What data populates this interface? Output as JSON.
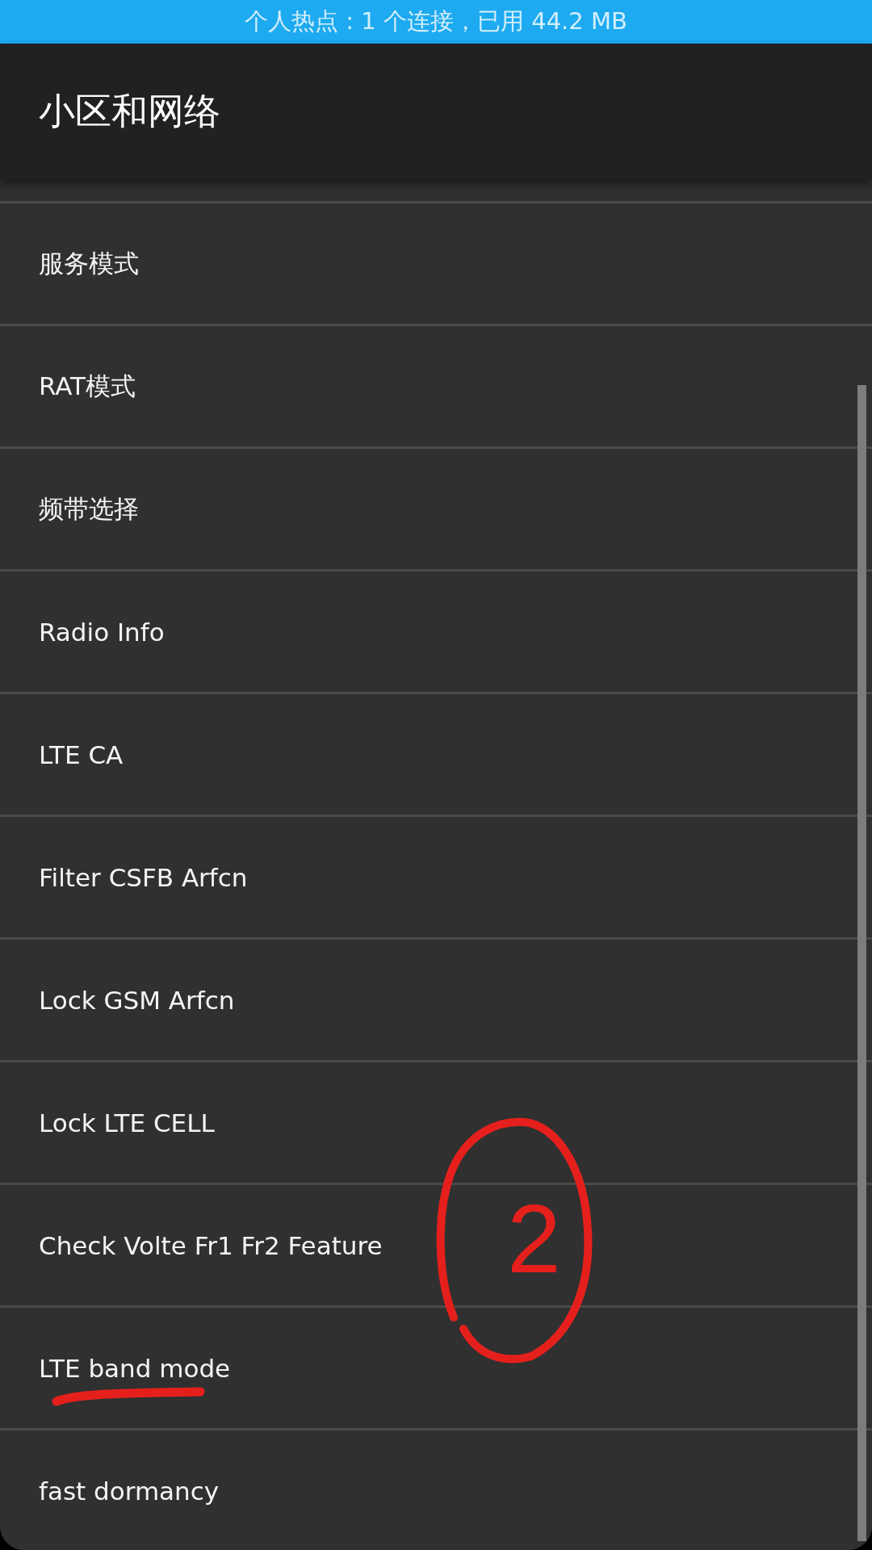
{
  "status_bar": {
    "text": "个人热点 : 1 个连接，已用 44.2 MB"
  },
  "app_bar": {
    "title": "小区和网络"
  },
  "list": {
    "items": [
      {
        "label": "服务模式",
        "underlined": false
      },
      {
        "label": "RAT模式",
        "underlined": false
      },
      {
        "label": "频带选择",
        "underlined": false
      },
      {
        "label": "Radio Info",
        "underlined": false
      },
      {
        "label": "LTE CA",
        "underlined": false
      },
      {
        "label": "Filter CSFB Arfcn",
        "underlined": false
      },
      {
        "label": "Lock GSM Arfcn",
        "underlined": false
      },
      {
        "label": "Lock LTE CELL",
        "underlined": false
      },
      {
        "label": "Check Volte Fr1 Fr2 Feature",
        "underlined": false
      },
      {
        "label": "LTE band mode",
        "underlined": true
      },
      {
        "label": "fast dormancy",
        "underlined": false
      }
    ]
  },
  "annotation": {
    "label": "2"
  }
}
